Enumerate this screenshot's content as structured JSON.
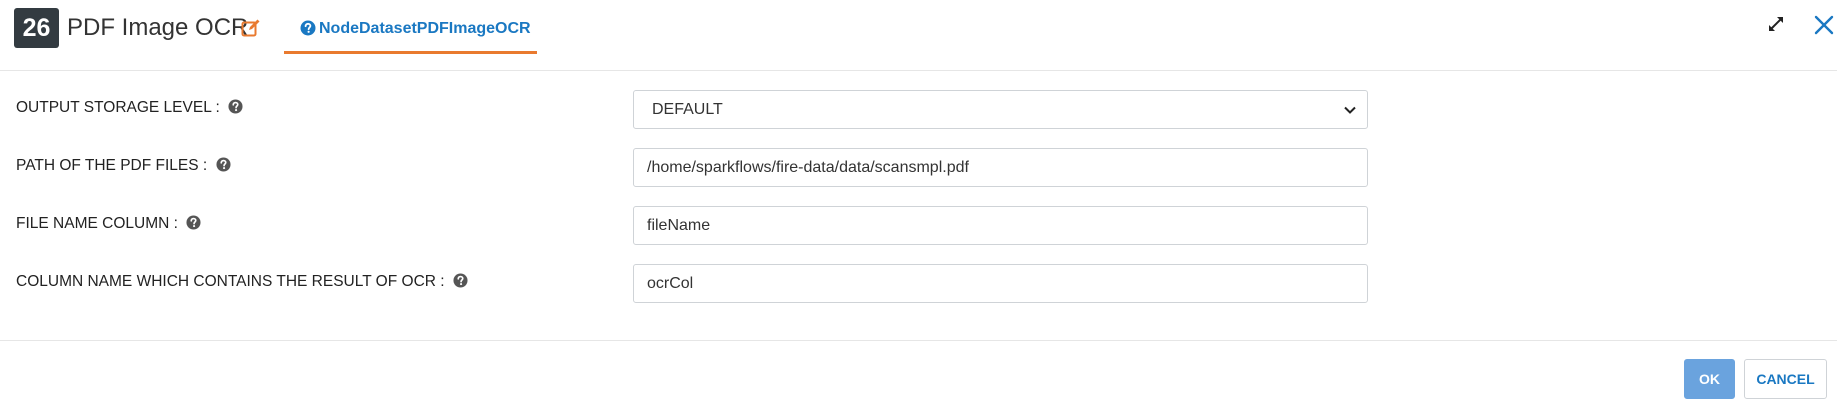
{
  "header": {
    "node_number": "26",
    "title": "PDF Image OCR",
    "tab_label": "NodeDatasetPDFImageOCR",
    "accent_color": "#e97a2f",
    "link_color": "#1a78c2"
  },
  "fields": [
    {
      "label": "OUTPUT STORAGE LEVEL :",
      "value": "DEFAULT",
      "type": "select"
    },
    {
      "label": "PATH OF THE PDF FILES :",
      "value": "/home/sparkflows/fire-data/data/scansmpl.pdf",
      "type": "text"
    },
    {
      "label": "FILE NAME COLUMN :",
      "value": "fileName",
      "type": "text"
    },
    {
      "label": "COLUMN NAME WHICH CONTAINS THE RESULT OF OCR :",
      "value": "ocrCol",
      "type": "text"
    }
  ],
  "footer": {
    "ok_label": "OK",
    "cancel_label": "CANCEL"
  },
  "icons": [
    "edit-icon",
    "help-icon",
    "expand-icon",
    "close-icon",
    "chevron-down-icon"
  ]
}
